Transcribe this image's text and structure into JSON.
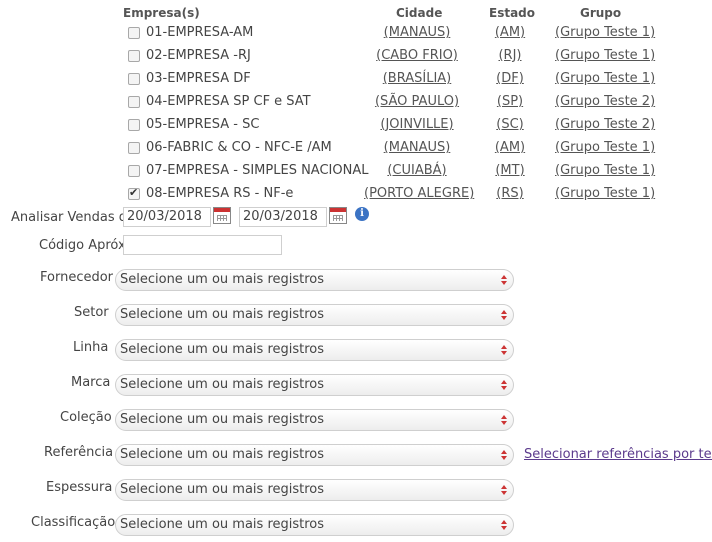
{
  "headers": {
    "empresa": "Empresa(s)",
    "cidade": "Cidade",
    "estado": "Estado",
    "grupo": "Grupo"
  },
  "companies": [
    {
      "name": "01-EMPRESA-AM",
      "city": "(MANAUS)",
      "state": "(AM)",
      "group": "(Grupo Teste 1)",
      "checked": false
    },
    {
      "name": "02-EMPRESA -RJ",
      "city": "(CABO FRIO)",
      "state": "(RJ)",
      "group": "(Grupo Teste 1)",
      "checked": false
    },
    {
      "name": "03-EMPRESA DF",
      "city": "(BRASÍLIA)",
      "state": "(DF)",
      "group": "(Grupo Teste 1)",
      "checked": false
    },
    {
      "name": "04-EMPRESA SP CF e SAT",
      "city": "(SÃO PAULO)",
      "state": "(SP)",
      "group": "(Grupo Teste 2)",
      "checked": false
    },
    {
      "name": "05-EMPRESA - SC",
      "city": "(JOINVILLE)",
      "state": "(SC)",
      "group": "(Grupo Teste 2)",
      "checked": false
    },
    {
      "name": "06-FABRIC & CO - NFC-E /AM",
      "city": "(MANAUS)",
      "state": "(AM)",
      "group": "(Grupo Teste 1)",
      "checked": false
    },
    {
      "name": "07-EMPRESA - SIMPLES NACIONAL",
      "city": "(CUIABÁ)",
      "state": "(MT)",
      "group": "(Grupo Teste 1)",
      "checked": false
    },
    {
      "name": "08-EMPRESA RS - NF-e",
      "city": "(PORTO ALEGRE)",
      "state": "(RS)",
      "group": "(Grupo Teste 1)",
      "checked": true
    }
  ],
  "vendas": {
    "label": "Analisar Vendas de",
    "date_from": "20/03/2018",
    "date_to": "20/03/2018"
  },
  "codigo": {
    "label": "Código Apróx.:",
    "value": ""
  },
  "filters": [
    {
      "label": "Fornecedor",
      "placeholder": "Selecione um ou mais registros"
    },
    {
      "label": "Setor",
      "placeholder": "Selecione um ou mais registros"
    },
    {
      "label": "Linha",
      "placeholder": "Selecione um ou mais registros"
    },
    {
      "label": "Marca",
      "placeholder": "Selecione um ou mais registros"
    },
    {
      "label": "Coleção",
      "placeholder": "Selecione um ou mais registros"
    },
    {
      "label": "Referência",
      "placeholder": "Selecione um ou mais registros"
    },
    {
      "label": "Espessura",
      "placeholder": "Selecione um ou mais registros"
    },
    {
      "label": "Classificação",
      "placeholder": "Selecione um ou mais registros"
    }
  ],
  "referencia_link": "Selecionar referências por texto",
  "colors": {
    "link_visited": "#5b3a8c",
    "arrow": "#cc3333",
    "info": "#3b73c4"
  }
}
